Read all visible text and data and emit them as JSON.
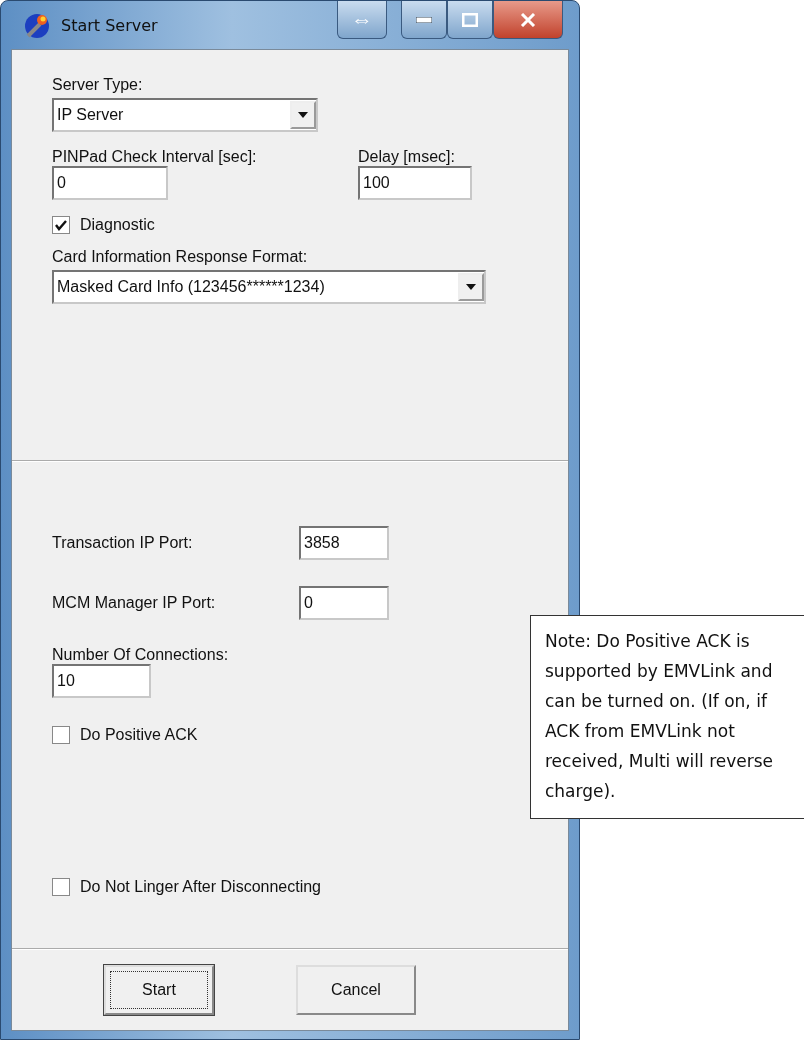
{
  "window": {
    "title": "Start Server",
    "resize_glyph": "⇔"
  },
  "top_section": [
    {
      "kind": "combo",
      "label": "Server Type:",
      "value": "IP Server"
    },
    {
      "kind": "pair",
      "fields": [
        {
          "label": "PINPad Check Interval [sec]:",
          "value": "0"
        },
        {
          "label": "Delay [msec]:",
          "value": "100"
        }
      ]
    },
    {
      "kind": "checkbox",
      "label": "Diagnostic",
      "checked": true
    },
    {
      "kind": "combo",
      "label": "Card Information Response Format:",
      "value": "Masked Card Info (123456******1234)"
    }
  ],
  "bottom_section": [
    {
      "kind": "inline",
      "label": "Transaction IP Port:",
      "value": "3858"
    },
    {
      "kind": "inline",
      "label": "MCM Manager IP Port:",
      "value": "0"
    },
    {
      "kind": "stacked",
      "label": "Number Of Connections:",
      "value": "10"
    },
    {
      "kind": "checkbox",
      "label": "Do Positive ACK",
      "checked": false
    },
    {
      "kind": "checkbox",
      "label": "Do Not Linger After Disconnecting",
      "checked": false
    }
  ],
  "buttons": [
    {
      "label": "Start",
      "default": true
    },
    {
      "label": "Cancel",
      "default": false
    }
  ],
  "note": "Note: Do Positive ACK is supported by EMVLink and can be turned on.  (If on, if ACK from EMVLink not received, Multi will reverse charge)."
}
